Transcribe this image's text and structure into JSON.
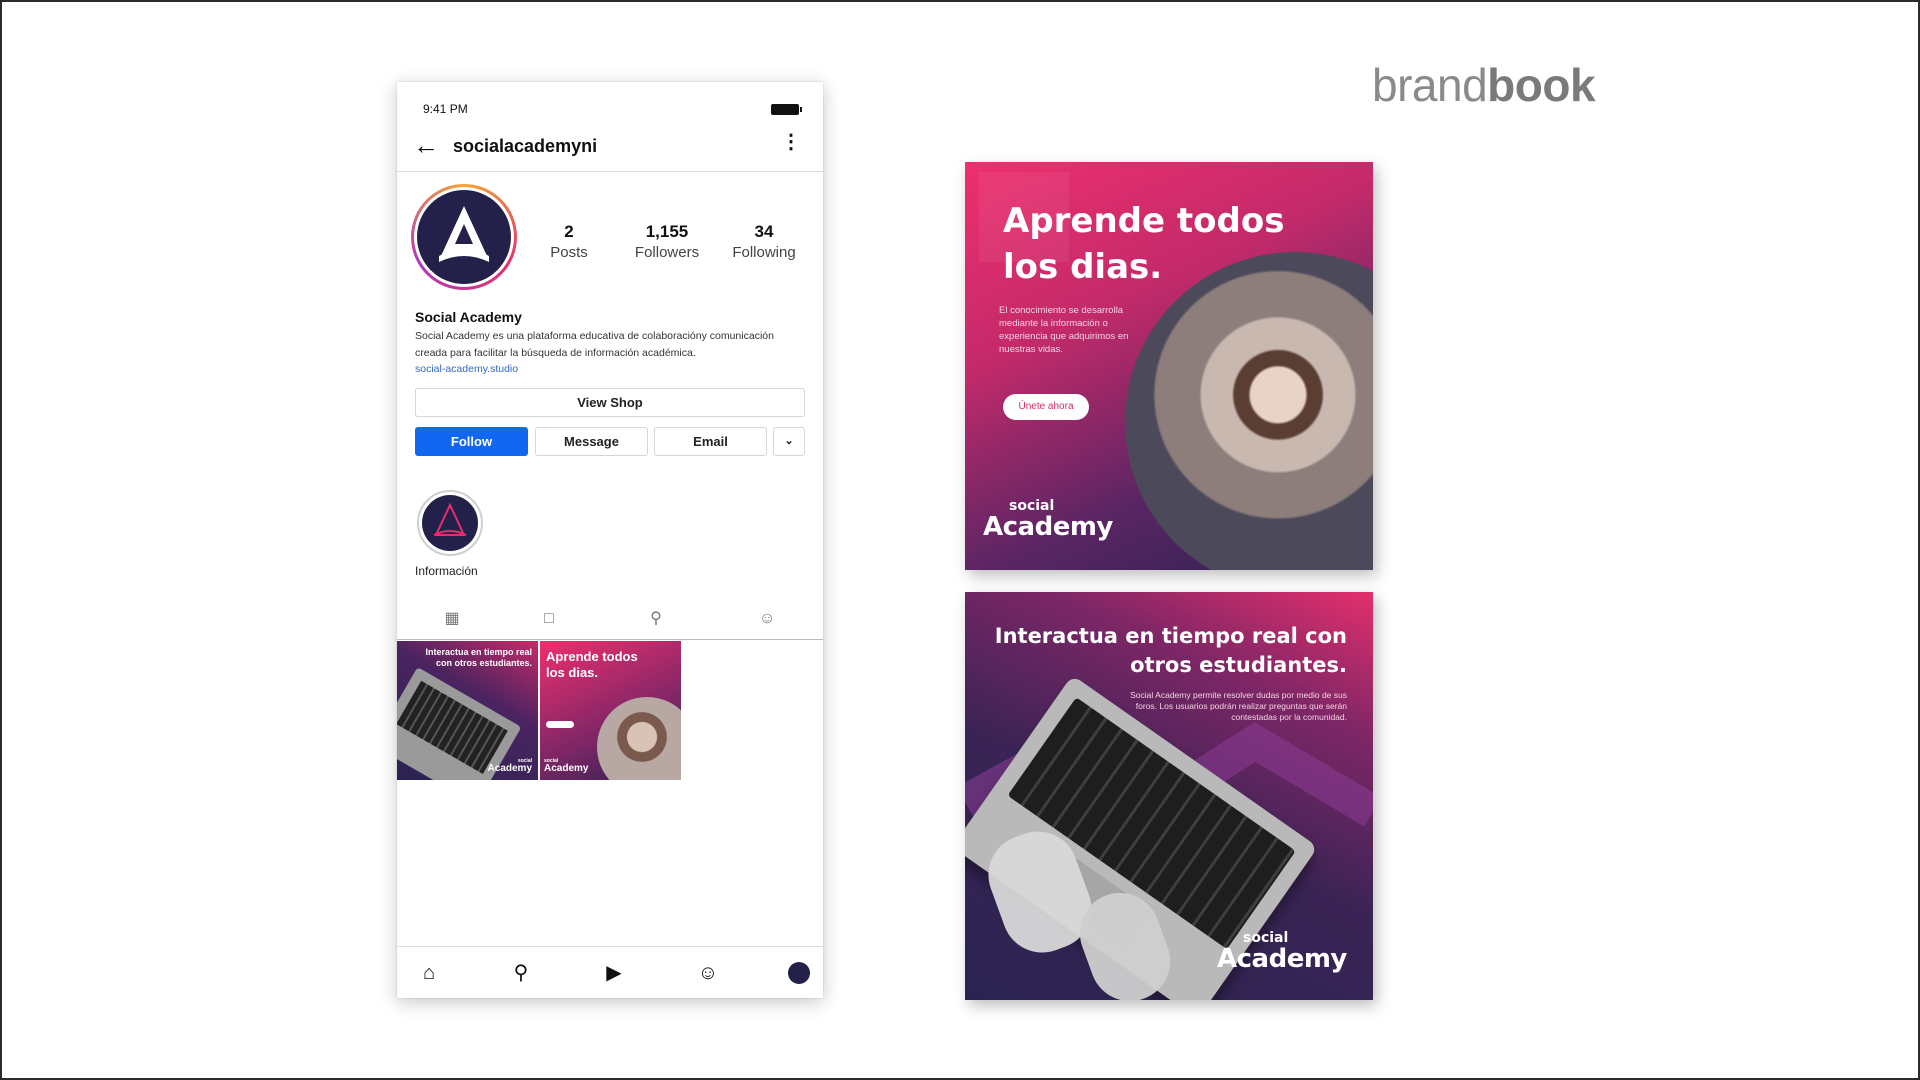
{
  "brand": {
    "light": "brand",
    "bold": "book"
  },
  "phone": {
    "status_time": "9:41 PM",
    "username": "socialacademyni",
    "stats": [
      {
        "value": "2",
        "label": "Posts"
      },
      {
        "value": "1,155",
        "label": "Followers"
      },
      {
        "value": "34",
        "label": "Following"
      }
    ],
    "bio": {
      "name": "Social Academy",
      "text": "Social Academy es una plataforma educativa de colaboracióny comunicación creada para facilitar la búsqueda de información académica.",
      "link": "social-academy.studio"
    },
    "buttons": {
      "view_shop": "View Shop",
      "follow": "Follow",
      "message": "Message",
      "email": "Email"
    },
    "highlight_label": "Información",
    "thumb1": {
      "title": "Interactua en tiempo real con otros estudiantes.",
      "logo_small": "social",
      "logo_big": "Academy"
    },
    "thumb2": {
      "title": "Aprende todos los dias.",
      "logo_small": "social",
      "logo_big": "Academy"
    }
  },
  "post1": {
    "title_line1": "Aprende todos",
    "title_line2": "los dias.",
    "text": "El conocimiento se desarrolla mediante la información o experiencia que adquirimos en nuestras vidas.",
    "cta": "Únete ahora",
    "logo_small": "social",
    "logo_big": "Academy"
  },
  "post2": {
    "title_line1": "Interactua en tiempo real con",
    "title_line2": "otros estudiantes.",
    "text": "Social Academy permite resolver dudas por medio de sus foros. Los usuarios podrán realizar preguntas que serán contestadas por la comunidad.",
    "logo_small": "social",
    "logo_big": "Academy"
  },
  "colors": {
    "accent": "#1167f0",
    "brand_pink": "#e42f6c",
    "brand_navy": "#23204a"
  }
}
